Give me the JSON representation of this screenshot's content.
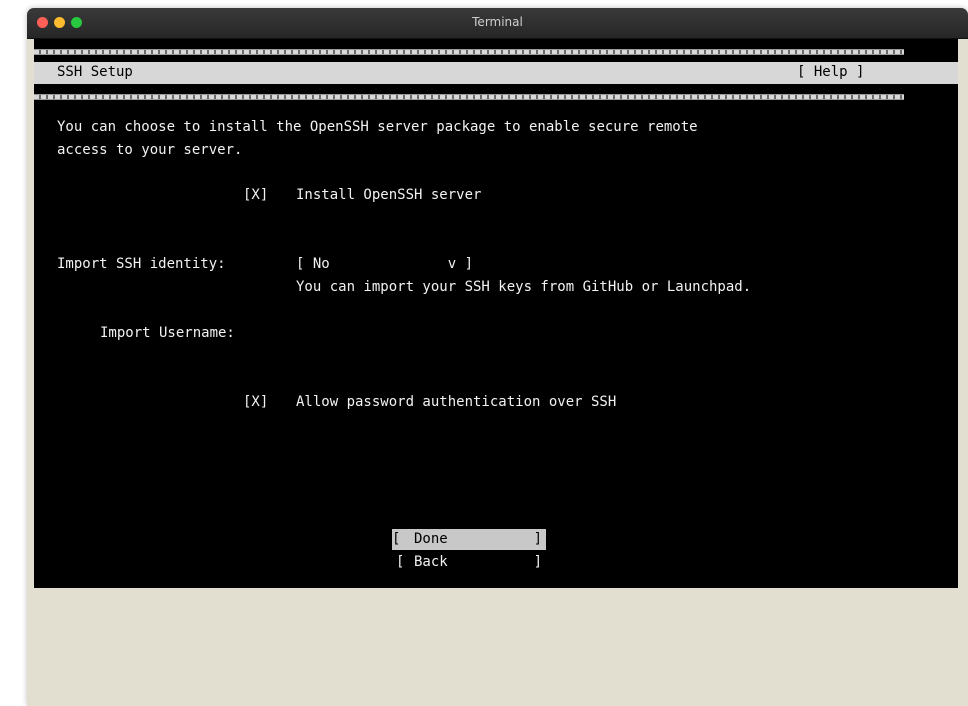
{
  "window": {
    "title": "Terminal"
  },
  "header": {
    "title": "SSH Setup",
    "help_label": "[ Help ]"
  },
  "intro": {
    "line1": "You can choose to install the OpenSSH server package to enable secure remote",
    "line2": "access to your server."
  },
  "install_option": {
    "checkbox": "[X]",
    "label": "Install OpenSSH server"
  },
  "import_identity": {
    "label": "Import SSH identity:",
    "value": "[ No              v ]",
    "help": "You can import your SSH keys from GitHub or Launchpad."
  },
  "import_username": {
    "label": "Import Username:"
  },
  "password_option": {
    "checkbox": "[X]",
    "label": "Allow password authentication over SSH"
  },
  "buttons": {
    "done": {
      "open": "[",
      "label": "Done",
      "close": "]"
    },
    "back": {
      "open": "[",
      "label": "Back",
      "close": "]"
    }
  },
  "colors": {
    "terminal_background": "#000000",
    "terminal_text": "#f2f2f2",
    "header_bar": "#d7d7d7",
    "window_background": "#e2dfd1",
    "close": "#fe5f57",
    "minimize": "#febc2e",
    "zoom": "#28c840"
  }
}
